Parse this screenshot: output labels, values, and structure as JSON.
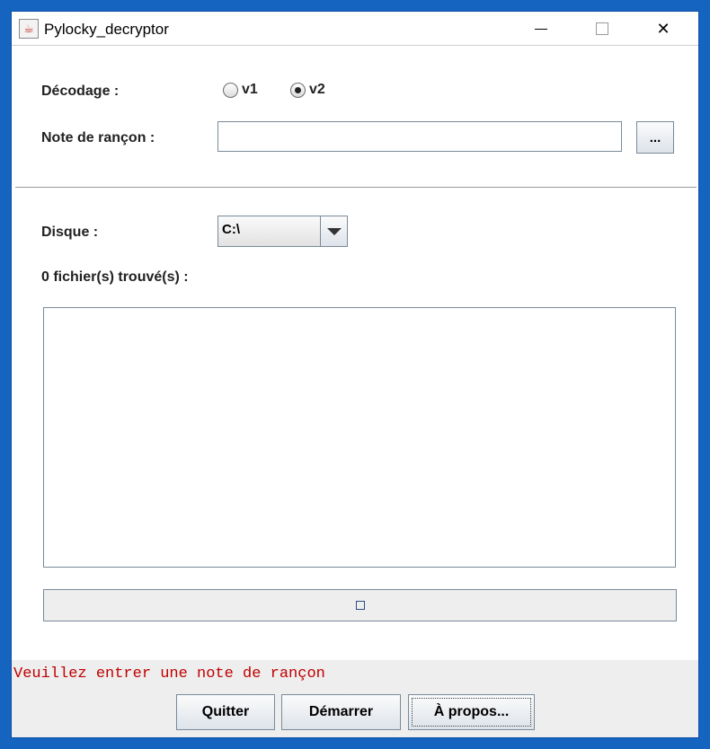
{
  "window": {
    "title": "Pylocky_decryptor",
    "controls": {
      "minimize": "minimize",
      "maximize": "maximize",
      "close": "✕"
    }
  },
  "decoding": {
    "label": "Décodage :",
    "options": [
      {
        "label": "v1",
        "selected": false
      },
      {
        "label": "v2",
        "selected": true
      }
    ]
  },
  "ransom_note": {
    "label": "Note de rançon :",
    "value": "",
    "placeholder": "",
    "browse_label": "..."
  },
  "disk": {
    "label": "Disque :",
    "selected": "C:\\"
  },
  "files_found": {
    "label": "0 fichier(s) trouvé(s)  :",
    "items": []
  },
  "progress": {
    "percent": 0
  },
  "status": {
    "message": "Veuillez entrer une note de rançon",
    "color": "#c00000"
  },
  "buttons": {
    "quit": "Quitter",
    "start": "Démarrer",
    "about": "À propos..."
  }
}
